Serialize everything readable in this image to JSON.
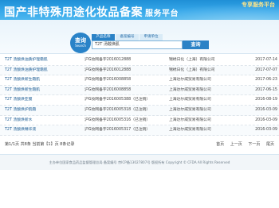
{
  "header": {
    "title": "国产非特殊用途化妆品备案",
    "subtitle": "服务平台",
    "top_link": "专享服务平台"
  },
  "search": {
    "logo_cn": "查询",
    "logo_en": "Search",
    "tabs": [
      {
        "label": "产品名称"
      },
      {
        "label": "备案编号"
      },
      {
        "label": "申请单位"
      }
    ],
    "query": "T2T 汤酸焕肌",
    "button_label": "查询"
  },
  "results": [
    {
      "name": "T2T 汤酸焕油质护理霜肌",
      "no": "沪G妆网备字2016012888",
      "company": "锦绣日化（上海）有限公司",
      "date": "2017-07-14"
    },
    {
      "name": "T2T 汤酸焕油质护理霜肌",
      "no": "沪G妆网备字2016012888",
      "company": "锦绣日化（上海）有限公司",
      "date": "2017-07-07"
    },
    {
      "name": "T2T 汤酸焕新生霜肌",
      "no": "沪G妆网备字2016008858",
      "company": "上海达尔威贸易有限公司",
      "date": "2017-06-23"
    },
    {
      "name": "T2T 汤酸焕新生霜肌",
      "no": "沪G妆网备字2016008858",
      "company": "上海达尔威贸易有限公司",
      "date": "2017-06-15"
    },
    {
      "name": "T2T 汤酸焕亚膜",
      "no": "沪G妆网备字2016005388（已注销）",
      "company": "上海达尔威贸易有限公司",
      "date": "2016-08-19"
    },
    {
      "name": "T2T 汤酸焕护肌霜",
      "no": "沪G妆网备字2016005318（已注销）",
      "company": "上海达尔威贸易有限公司",
      "date": "2016-03-09"
    },
    {
      "name": "T2T 汤酸焕新水",
      "no": "沪G妆网备字2016005316（已注销）",
      "company": "上海达尔威贸易有限公司",
      "date": "2016-03-09"
    },
    {
      "name": "T2T 汤酸焕精华液",
      "no": "沪G妆网备字2016005317（已注销）",
      "company": "上海达尔威贸易有限公司",
      "date": "2016-03-09"
    }
  ],
  "pager": {
    "info": "第1/1页 共8条 当前第【1】页 8条记录",
    "first": "首页",
    "prev": "上一页",
    "next": "下一页",
    "last": "尾页"
  },
  "footer": {
    "text": "主办单位国家食品药品监督管理总局 备案编号 京ICP备13027807号 版权所有 Copyright © CFDA All Rights Reserved"
  }
}
